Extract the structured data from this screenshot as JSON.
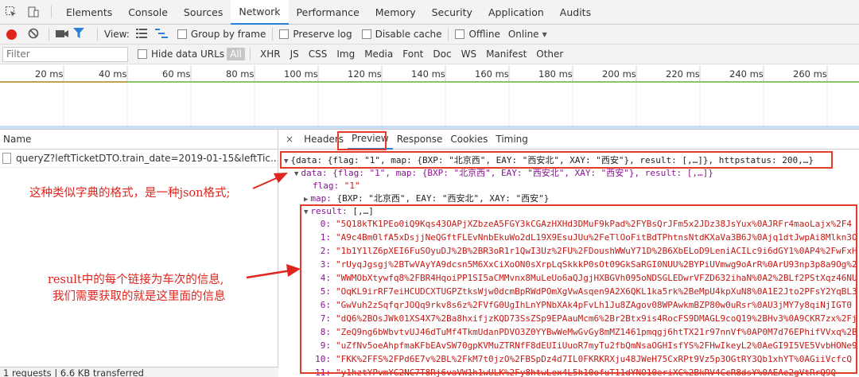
{
  "topbar": {
    "tabs": [
      "Elements",
      "Console",
      "Sources",
      "Network",
      "Performance",
      "Memory",
      "Security",
      "Application",
      "Audits"
    ],
    "active_tab": "Network"
  },
  "toolbar": {
    "view_label": "View:",
    "group_by_frame": "Group by frame",
    "preserve_log": "Preserve log",
    "disable_cache": "Disable cache",
    "offline": "Offline",
    "throttle": "Online"
  },
  "filterbar": {
    "placeholder": "Filter",
    "hide_data_urls": "Hide data URLs",
    "types": [
      "All",
      "XHR",
      "JS",
      "CSS",
      "Img",
      "Media",
      "Font",
      "Doc",
      "WS",
      "Manifest",
      "Other"
    ]
  },
  "timeline": {
    "ticks": [
      "20 ms",
      "40 ms",
      "60 ms",
      "80 ms",
      "100 ms",
      "120 ms",
      "140 ms",
      "160 ms",
      "180 ms",
      "200 ms",
      "220 ms",
      "240 ms",
      "260 ms"
    ]
  },
  "requests": {
    "header": "Name",
    "row": "queryZ?leftTicketDTO.train_date=2019-01-15&leftTic...&left...",
    "status": "1 requests | 6.6 KB transferred"
  },
  "detail": {
    "close": "×",
    "tabs": [
      "Headers",
      "Preview",
      "Response",
      "Cookies",
      "Timing"
    ],
    "active_tab": "Preview"
  },
  "preview": {
    "root": "{data: {flag: \"1\", map: {BXP: \"北京西\", EAY: \"西安北\", XAY: \"西安\"}, result: [,…]}, httpstatus: 200,…}",
    "data_line": "data: {flag: \"1\", map: {BXP: \"北京西\", EAY: \"西安北\", XAY: \"西安\"}, result: [,…]}",
    "flag_key": "flag:",
    "flag_val": "\"1\"",
    "map_key": "map:",
    "map_val": "{BXP: \"北京西\", EAY: \"西安北\", XAY: \"西安\"}",
    "result_key": "result:",
    "result_val": "[,…]",
    "results": [
      {
        "i": "0:",
        "v": "\"5Q18kTK1PEo0iQ9Kqs43OAPjXZbzeA5FGY3kCGAzHXHd3DMuF9kPad%2FYBsQrJFm5x2JDz38JsYux%0AJRFr4maoLajx%2F4"
      },
      {
        "i": "1:",
        "v": "\"A9c4Bm0lfA5xDsjjNeQGftFLEvNnbEkuWo2dL19X9EsuJUu%2FeTlOoFitBdTPhtnsNtdKXaVa3B6J%0Ajq1dtJwpAi8Mlkn3O"
      },
      {
        "i": "2:",
        "v": "\"1b1Y1lZ6pXEI6FuSOyuDJ%2B%2BR3oR1r1QwI3Uz%2FU%2FDoushWWuY71D%2B6XbELoD9LeniACILc9i6dGY1%0AP4%2FwFxH"
      },
      {
        "i": "3:",
        "v": "\"rUyqJgsgj%2BTwVAyYA9dcsn5M6XxCiXoON0sXrpLqSkkkP0sOt09GkSaRGI0NUU%2BYPiUVmwg9oArR%0ArU93np3p8a9Og%2"
      },
      {
        "i": "4:",
        "v": "\"WWMObXtywfq8%2FBR4HqoiPP1SI5aCMMvnx8MuLeUo6aQJgjHXBGVh095oNDSGLEDwrVFZD632ihaN%0A2%2BLf2PStXqz46NU"
      },
      {
        "i": "5:",
        "v": "\"OqKL9irRF7eiHCUDCXTUGPZtksWjw0dcmBpRWdPOmXgVwAsqen9A2X6QKL1ka5rk%2BeMpU4kpXuN8%0A1E2Jto2PFsY2YqBL3"
      },
      {
        "i": "6:",
        "v": "\"GwVuh2zSqfqrJOQq9rkv8s6z%2FVfG0UgIhLnYPNbXAk4pFvLh1Ju8ZAgov08WPAwkmBZP80w0uRsr%0AU3jMY7y8qiNjIGT0"
      },
      {
        "i": "7:",
        "v": "\"dQ6%2BOsJWk01XS4X7%2Ba8hxifjzKQD73SsZSp9EPAauMcm6%2Br2Btx9is4RocFS9DMAGL9coQ19%2BHv3%0A9CKR7zx%2Fj"
      },
      {
        "i": "8:",
        "v": "\"ZeQ9ng6bWbvtvUJ46dTuMf4TkmUdanPDVO3Z0YYBwWeMwGvGy8mMZ1461pmqgj6htTX21r97nnVf%0AP0M7d76EPhifVVxq%2B"
      },
      {
        "i": "9:",
        "v": "\"uZfNv5oeAhpfmaKFbEAvSW70gpKVMuZTRNfF8dEUIiUuoR7myTu2fbQmNsaOGHIsfYS%2FHwIkeyL2%0AeGI9I5VE5VvbHONe9"
      },
      {
        "i": "10:",
        "v": "\"FKK%2FFS%2FPd6E7v%2BL%2FkM7t0jzO%2FBSpDz4d7IL0FKRKRXju48JWeH75CxRPt9Vz5p3OGtRY3Qb1xhYT%0AGiiVcfcQ"
      },
      {
        "i": "11:",
        "v": "\"y1hztYPvmYG2NC7T8Rj6vaVW1h1wULK%2Fy8htwLex4L5h10ofuT11dYNO10eriXC%2BkRV4CcR8dsY%0AEAe2gVtRrQ9Q"
      }
    ]
  },
  "annotations": {
    "json_note": "这种类似字典的格式，是一种json格式;",
    "result_note_1": "result中的每个链接为车次的信息,",
    "result_note_2": "我们需要获取的就是这里面的信息"
  }
}
